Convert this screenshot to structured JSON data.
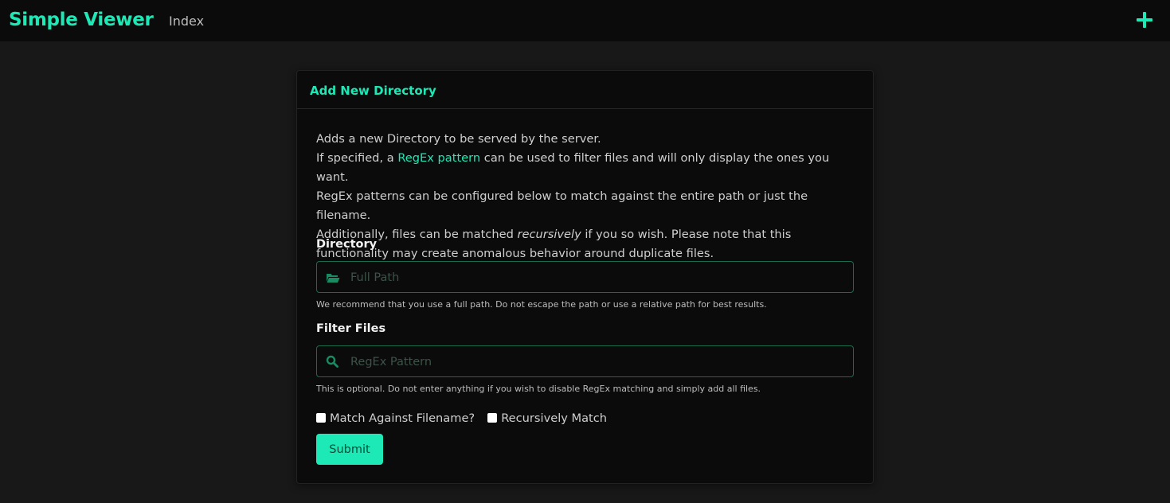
{
  "navbar": {
    "brand": "Simple Viewer",
    "link_index": "Index",
    "add_icon": "plus-icon",
    "accent_color": "#1de9b6"
  },
  "card": {
    "title": "Add New Directory",
    "description": {
      "line1": "Adds a new Directory to be served by the server.",
      "line2_pre": "If specified, a ",
      "line2_link": "RegEx pattern",
      "line2_post": " can be used to filter files and will only display the ones you want.",
      "line3": "RegEx patterns can be configured below to match against the entire path or just the filename.",
      "line4_pre": "Additionally, files can be matched ",
      "line4_em": "recursively",
      "line4_post": " if you so wish. Please note that this functionality may create anomalous behavior around duplicate files."
    },
    "directory": {
      "label": "Directory",
      "icon": "folder-open-icon",
      "placeholder": "Full Path",
      "value": "",
      "help": "We recommend that you use a full path. Do not escape the path or use a relative path for best results."
    },
    "filter": {
      "label": "Filter Files",
      "icon": "search-icon",
      "placeholder": "RegEx Pattern",
      "value": "",
      "help": "This is optional. Do not enter anything if you wish to disable RegEx matching and simply add all files."
    },
    "checkboxes": {
      "match_filename": {
        "label": "Match Against Filename?",
        "checked": false
      },
      "recursive": {
        "label": "Recursively Match",
        "checked": false
      }
    },
    "submit_label": "Submit"
  }
}
